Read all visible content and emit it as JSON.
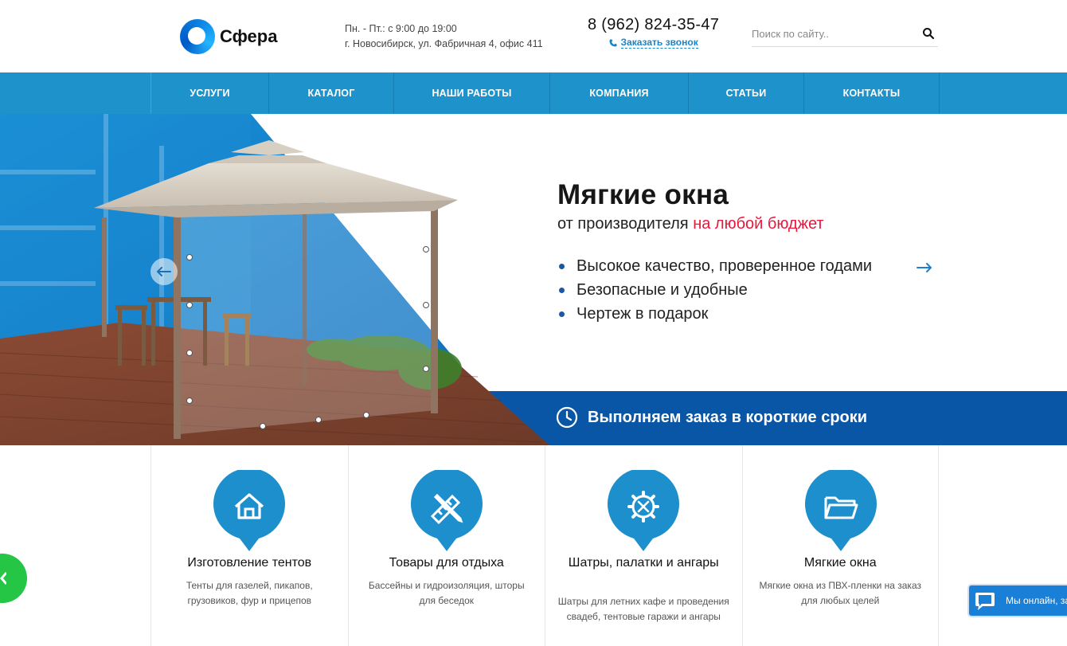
{
  "header": {
    "logo_text": "Сфера",
    "hours_line1": "Пн. - Пт.: с 9:00 до 19:00",
    "hours_line2": "г. Новосибирск, ул. Фабричная 4, офис 411",
    "phone": "8 (962) 824-35-47",
    "callback_label": "Заказать звонок",
    "search_placeholder": "Поиск по сайту..",
    "search_icon": "search-icon"
  },
  "nav": {
    "items": [
      {
        "label": "УСЛУГИ"
      },
      {
        "label": "КАТАЛОГ"
      },
      {
        "label": "НАШИ РАБОТЫ"
      },
      {
        "label": "КОМПАНИЯ"
      },
      {
        "label": "СТАТЬИ"
      },
      {
        "label": "КОНТАКТЫ"
      }
    ]
  },
  "hero": {
    "title": "Мягкие окна",
    "subtitle_prefix": "от производителя ",
    "subtitle_accent": "на любой бюджет",
    "bullets": [
      "Высокое качество, проверенное годами",
      "Безопасные и удобные",
      "Чертеж в подарок"
    ],
    "bar_text": "Выполняем заказ в короткие сроки"
  },
  "services": [
    {
      "icon": "house-icon",
      "title": "Изготовление тентов",
      "desc": "Тенты для газелей, пикапов, грузовиков, фур и прицепов"
    },
    {
      "icon": "ruler-pencil-icon",
      "title": "Товары для отдыха",
      "desc": "Бассейны и гидроизоляция, шторы для беседок"
    },
    {
      "icon": "gear-tools-icon",
      "title": "Шатры, палатки и ангары",
      "desc": "Шатры для летних кафе и проведения свадеб, тентовые гаражи и ангары"
    },
    {
      "icon": "folder-icon",
      "title": "Мягкие окна",
      "desc": "Мягкие окна из ПВХ-пленки на заказ для любых целей"
    }
  ],
  "chat": {
    "label": "Мы онлайн, за"
  },
  "colors": {
    "brand_blue": "#1e93cb",
    "dark_blue": "#0a56a6",
    "accent_red": "#e8173b"
  }
}
